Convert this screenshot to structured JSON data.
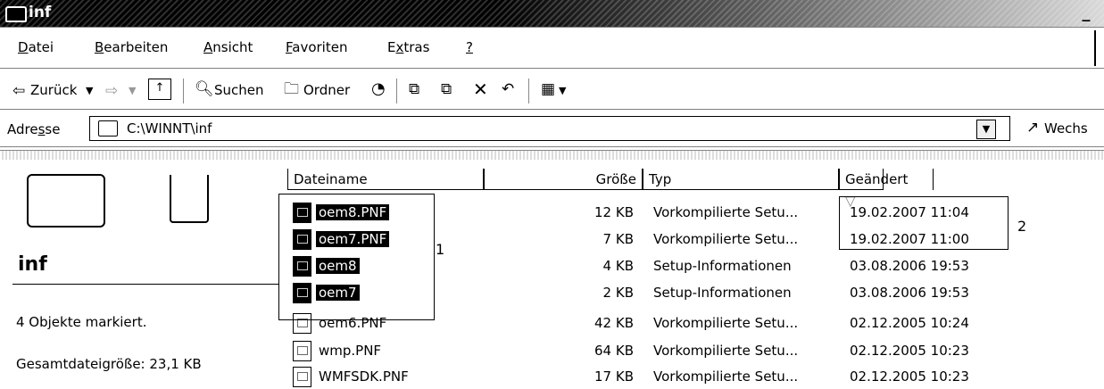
{
  "window": {
    "title": "inf",
    "minimize_glyph": "_"
  },
  "menu": [
    {
      "pre": "",
      "acc": "D",
      "post": "atei"
    },
    {
      "pre": "",
      "acc": "B",
      "post": "earbeiten"
    },
    {
      "pre": "",
      "acc": "A",
      "post": "nsicht"
    },
    {
      "pre": "",
      "acc": "F",
      "post": "avoriten"
    },
    {
      "pre": "E",
      "acc": "x",
      "post": "tras"
    },
    {
      "pre": "",
      "acc": "?",
      "post": ""
    }
  ],
  "toolbar": {
    "back_label": "Zurück",
    "search_label": "Suchen",
    "folders_label": "Ordner"
  },
  "address": {
    "label_pre": "Adre",
    "label_acc": "s",
    "label_post": "se",
    "value": "C:\\WINNT\\inf",
    "go_label": "Wechs"
  },
  "left_panel": {
    "folder_name": "inf",
    "status_selected": "4 Objekte markiert.",
    "status_total_size": "Gesamtdateigröße: 23,1 KB"
  },
  "columns": {
    "name": "Dateiname",
    "size": "Größe",
    "type": "Typ",
    "modified": "Geändert",
    "sort_glyph": "▽"
  },
  "files": [
    {
      "name": "oem8.PNF",
      "size": "12 KB",
      "type": "Vorkompilierte Setu...",
      "modified": "19.02.2007 11:04",
      "selected": true
    },
    {
      "name": "oem7.PNF",
      "size": "7 KB",
      "type": "Vorkompilierte Setu...",
      "modified": "19.02.2007 11:00",
      "selected": true
    },
    {
      "name": "oem8",
      "size": "4 KB",
      "type": "Setup-Informationen",
      "modified": "03.08.2006 19:53",
      "selected": true
    },
    {
      "name": "oem7",
      "size": "2 KB",
      "type": "Setup-Informationen",
      "modified": "03.08.2006 19:53",
      "selected": true
    },
    {
      "name": "oem6.PNF",
      "size": "42 KB",
      "type": "Vorkompilierte Setu...",
      "modified": "02.12.2005 10:24",
      "selected": false
    },
    {
      "name": "wmp.PNF",
      "size": "64 KB",
      "type": "Vorkompilierte Setu...",
      "modified": "02.12.2005 10:23",
      "selected": false
    },
    {
      "name": "WMFSDK.PNF",
      "size": "17 KB",
      "type": "Vorkompilierte Setu...",
      "modified": "02.12.2005 10:23",
      "selected": false
    }
  ],
  "annotations": {
    "selection_marker": "1",
    "dates_marker": "2"
  }
}
